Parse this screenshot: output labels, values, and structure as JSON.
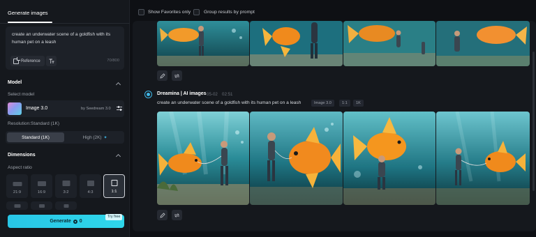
{
  "sidebar": {
    "tab_label": "Generate images",
    "prompt_text": "create an underwater scene of a goldfish with its human pet on a leash",
    "reference_label": "Reference",
    "char_count": "70/800",
    "model_section": "Model",
    "select_model_label": "Select model",
    "model_name": "Image 3.0",
    "model_by": "by Seedream 3.0",
    "resolution_label": "Resolution:Standard (1K)",
    "resolution_options": [
      "Standard (1K)",
      "High (2K)"
    ],
    "dimensions_section": "Dimensions",
    "aspect_ratio_label": "Aspect ratio",
    "aspect_ratios": [
      "21:9",
      "16:9",
      "3:2",
      "4:3",
      "1:1"
    ],
    "selected_ratio": "1:1",
    "generate_label": "Generate",
    "generate_cost": "0",
    "try_free_badge": "Try free"
  },
  "topbar": {
    "show_favorites": "Show Favorites only",
    "group_results": "Group results by prompt"
  },
  "generation": {
    "author": "Dreamina | AI images",
    "date": "05-02",
    "time": "02:51",
    "prompt": "create an underwater scene of a goldfish with its human pet on a leash",
    "tags": [
      "Image 3.0",
      "1:1",
      "1K"
    ]
  },
  "icons": {
    "edit": "pencil-icon",
    "regenerate": "repeat-icon",
    "spark": "sparkle-icon"
  },
  "colors": {
    "accent": "#2fd6ea",
    "background": "#0e1014",
    "panel": "#15181d"
  }
}
